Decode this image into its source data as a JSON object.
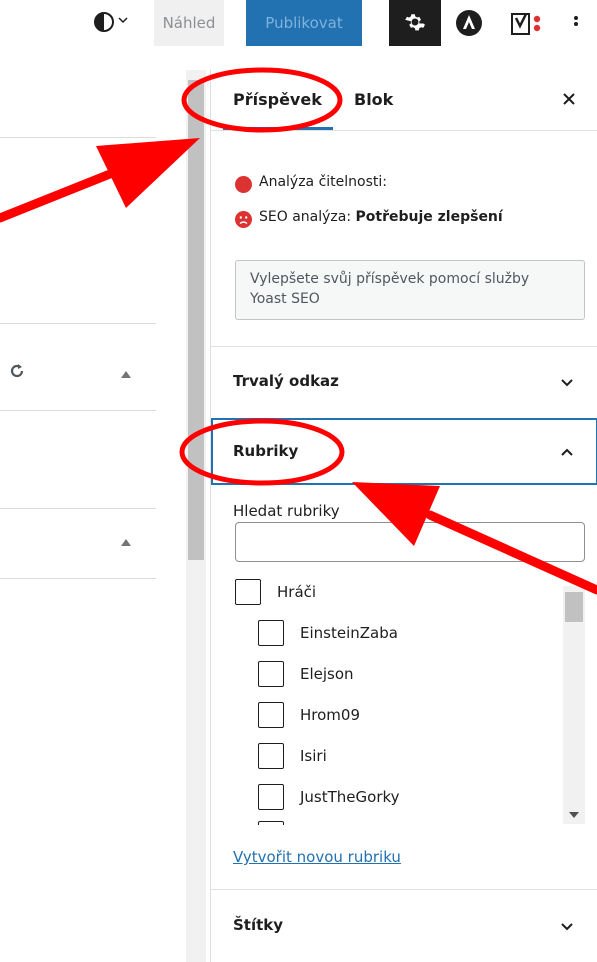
{
  "toolbar": {
    "contrast_icon": "half-circle-contrast-icon",
    "preview_label": "Náhled",
    "publish_label": "Publikovat",
    "settings_icon": "gear-icon",
    "astra_icon": "astra-logo-icon",
    "yoast_icon": "yoast-logo-icon",
    "more_icon": "vertical-ellipsis-icon"
  },
  "sidebar": {
    "tabs": [
      {
        "label": "Příspěvek",
        "active": true
      },
      {
        "label": "Blok",
        "active": false
      }
    ],
    "yoast": {
      "readability_label": "Analýza čitelnosti:",
      "readability_status_color": "#dc3232",
      "seo_label": "SEO analýza:",
      "seo_value": "Potřebuje zlepšení",
      "upgrade_button": "Vylepšete svůj příspěvek pomocí služby Yoast SEO"
    },
    "permalink": {
      "title": "Trvalý odkaz",
      "expanded": false
    },
    "categories": {
      "title": "Rubriky",
      "expanded": true,
      "search_label": "Hledat rubriky",
      "search_value": "",
      "items": [
        {
          "label": "Hráči",
          "checked": false,
          "level": 0
        },
        {
          "label": "EinsteinZaba",
          "checked": false,
          "level": 1
        },
        {
          "label": "Elejson",
          "checked": false,
          "level": 1
        },
        {
          "label": "Hrom09",
          "checked": false,
          "level": 1
        },
        {
          "label": "Isiri",
          "checked": false,
          "level": 1
        },
        {
          "label": "JustTheGorky",
          "checked": false,
          "level": 1
        }
      ],
      "new_category_link": "Vytvořit novou rubriku"
    },
    "tags": {
      "title": "Štítky",
      "expanded": false
    }
  },
  "colors": {
    "accent": "#2271b1",
    "annotation": "#ff0000",
    "dark": "#1e1e1e"
  }
}
